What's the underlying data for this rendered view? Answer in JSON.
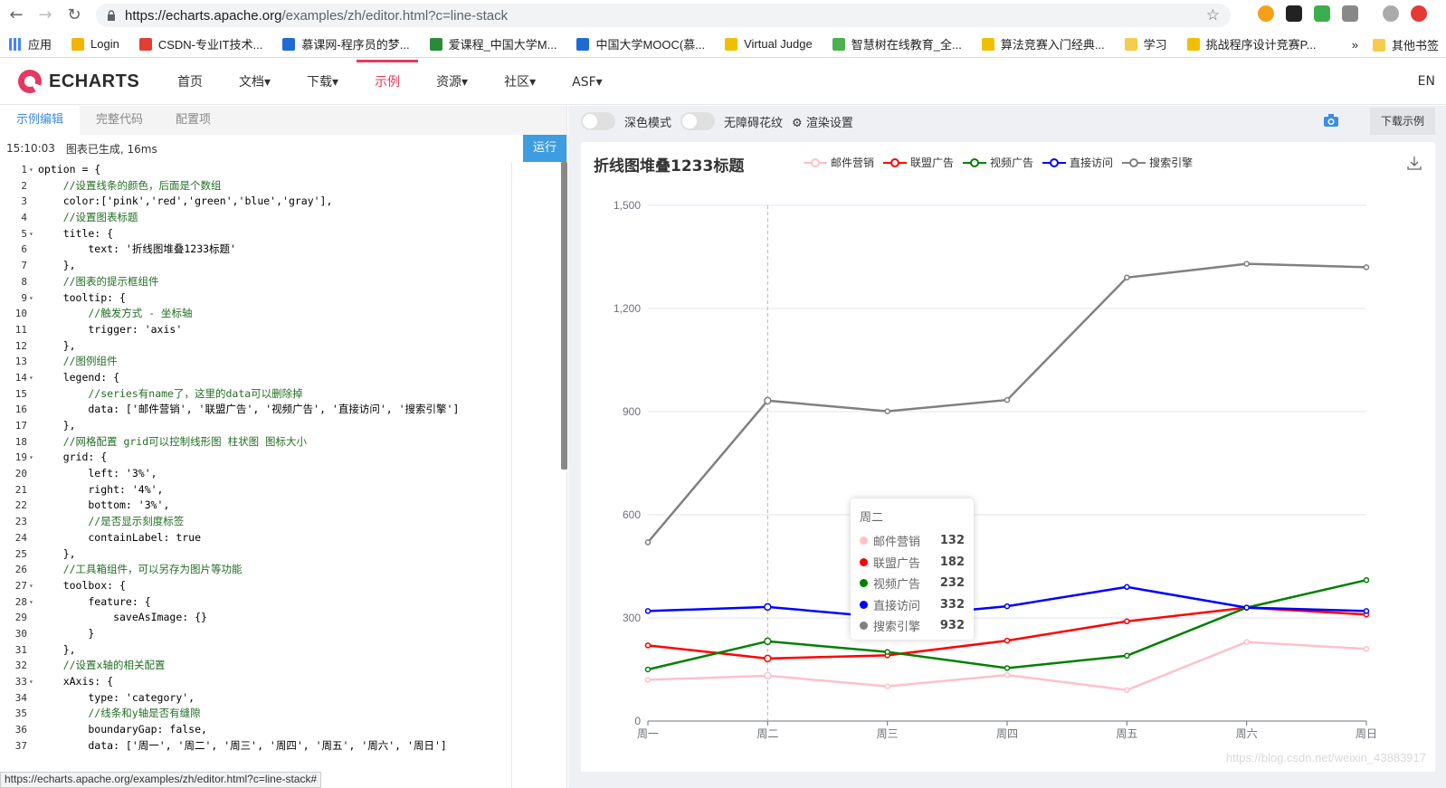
{
  "browser": {
    "url_host": "https://echarts.apache.org",
    "url_path": "/examples/zh/editor.html?c=line-stack",
    "bookmarks": [
      "应用",
      "Login",
      "CSDN-专业IT技术...",
      "慕课网-程序员的梦...",
      "爱课程_中国大学M...",
      "中国大学MOOC(慕...",
      "Virtual Judge",
      "智慧树在线教育_全...",
      "算法竞赛入门经典...",
      "学习",
      "挑战程序设计竞赛P..."
    ],
    "bookmarks_more": "»",
    "other_bookmarks": "其他书签"
  },
  "site": {
    "logo": "ECHARTS",
    "menu": [
      "首页",
      "文档▾",
      "下载▾",
      "示例",
      "资源▾",
      "社区▾",
      "ASF▾"
    ],
    "lang": "EN"
  },
  "editor": {
    "tabs": [
      "示例编辑",
      "完整代码",
      "配置项"
    ],
    "status_time": "15:10:03",
    "status_msg": "图表已生成, 16ms",
    "run_label": "运行",
    "footer_url": "https://echarts.apache.org/examples/zh/editor.html?c=line-stack#"
  },
  "code_lines": [
    {
      "n": "1",
      "fold": true,
      "t": "option = {"
    },
    {
      "n": "2",
      "t": "    //设置线条的颜色，后面是个数组",
      "cls": "cm"
    },
    {
      "n": "3",
      "t": "    color:['pink','red','green','blue','gray'],"
    },
    {
      "n": "4",
      "t": "    //设置图表标题",
      "cls": "cm"
    },
    {
      "n": "5",
      "fold": true,
      "t": "    title: {"
    },
    {
      "n": "6",
      "t": "        text: '折线图堆叠1233标题'"
    },
    {
      "n": "7",
      "t": "    },"
    },
    {
      "n": "8",
      "t": "    //图表的提示框组件",
      "cls": "cm"
    },
    {
      "n": "9",
      "fold": true,
      "t": "    tooltip: {"
    },
    {
      "n": "10",
      "t": "        //触发方式 - 坐标轴",
      "cls": "cm"
    },
    {
      "n": "11",
      "t": "        trigger: 'axis'"
    },
    {
      "n": "12",
      "t": "    },"
    },
    {
      "n": "13",
      "t": "    //图例组件",
      "cls": "cm"
    },
    {
      "n": "14",
      "fold": true,
      "t": "    legend: {"
    },
    {
      "n": "15",
      "t": "        //series有name了，这里的data可以删除掉",
      "cls": "cm"
    },
    {
      "n": "16",
      "t": "        data: ['邮件营销', '联盟广告', '视频广告', '直接访问', '搜索引擎']"
    },
    {
      "n": "17",
      "t": "    },"
    },
    {
      "n": "18",
      "t": "    //网格配置 grid可以控制线形图 柱状图 图标大小",
      "cls": "cm"
    },
    {
      "n": "19",
      "fold": true,
      "t": "    grid: {"
    },
    {
      "n": "20",
      "t": "        left: '3%',"
    },
    {
      "n": "21",
      "t": "        right: '4%',"
    },
    {
      "n": "22",
      "t": "        bottom: '3%',"
    },
    {
      "n": "23",
      "t": "        //是否显示刻度标签",
      "cls": "cm"
    },
    {
      "n": "24",
      "t": "        containLabel: true"
    },
    {
      "n": "25",
      "t": "    },"
    },
    {
      "n": "26",
      "t": "    //工具箱组件，可以另存为图片等功能",
      "cls": "cm"
    },
    {
      "n": "27",
      "fold": true,
      "t": "    toolbox: {"
    },
    {
      "n": "28",
      "fold": true,
      "t": "        feature: {"
    },
    {
      "n": "29",
      "t": "            saveAsImage: {}"
    },
    {
      "n": "30",
      "t": "        }"
    },
    {
      "n": "31",
      "t": "    },"
    },
    {
      "n": "32",
      "t": "    //设置x轴的相关配置",
      "cls": "cm"
    },
    {
      "n": "33",
      "fold": true,
      "t": "    xAxis: {"
    },
    {
      "n": "34",
      "t": "        type: 'category',"
    },
    {
      "n": "35",
      "t": "        //线条和y轴是否有缝隙",
      "cls": "cm"
    },
    {
      "n": "36",
      "t": "        boundaryGap: false,"
    },
    {
      "n": "37",
      "t": "        data: ['周一', '周二', '周三', '周四', '周五', '周六', '周日']"
    }
  ],
  "preview": {
    "dark_mode_label": "深色模式",
    "a11y_label": "无障碍花纹",
    "render_settings_label": "渲染设置",
    "download_label": "下载示例"
  },
  "chart_data": {
    "type": "line",
    "title": "折线图堆叠1233标题",
    "categories": [
      "周一",
      "周二",
      "周三",
      "周四",
      "周五",
      "周六",
      "周日"
    ],
    "ylim": [
      0,
      1500
    ],
    "yticks": [
      0,
      300,
      600,
      900,
      1200,
      1500
    ],
    "ytick_labels": [
      "0",
      "300",
      "600",
      "900",
      "1,200",
      "1,500"
    ],
    "legend_position": "top",
    "series": [
      {
        "name": "邮件营销",
        "color": "#ffc0cb",
        "values": [
          120,
          132,
          101,
          134,
          90,
          230,
          210
        ]
      },
      {
        "name": "联盟广告",
        "color": "#ff0000",
        "values": [
          220,
          182,
          191,
          234,
          290,
          330,
          310
        ]
      },
      {
        "name": "视频广告",
        "color": "#008000",
        "values": [
          150,
          232,
          201,
          154,
          190,
          330,
          410
        ]
      },
      {
        "name": "直接访问",
        "color": "#0000ff",
        "values": [
          320,
          332,
          301,
          334,
          390,
          330,
          320
        ]
      },
      {
        "name": "搜索引擎",
        "color": "#808080",
        "values": [
          520,
          932,
          901,
          934,
          1290,
          1330,
          1320
        ]
      }
    ],
    "tooltip": {
      "title": "周二",
      "rows": [
        {
          "name": "邮件营销",
          "value": "132",
          "color": "#ffc0cb"
        },
        {
          "name": "联盟广告",
          "value": "182",
          "color": "#ff0000"
        },
        {
          "name": "视频广告",
          "value": "232",
          "color": "#008000"
        },
        {
          "name": "直接访问",
          "value": "332",
          "color": "#0000ff"
        },
        {
          "name": "搜索引擎",
          "value": "932",
          "color": "#808080"
        }
      ]
    }
  },
  "watermark": "https://blog.csdn.net/weixin_43883917"
}
